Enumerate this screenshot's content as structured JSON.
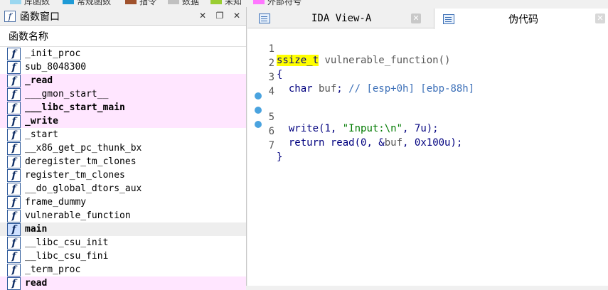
{
  "legend": [
    {
      "label": "库函数",
      "color": "#9ad7f0"
    },
    {
      "label": "常规函数",
      "color": "#1f9bd6"
    },
    {
      "label": "指令",
      "color": "#a0522d"
    },
    {
      "label": "数据",
      "color": "#c0c0c0"
    },
    {
      "label": "未知",
      "color": "#9acd32"
    },
    {
      "label": "外部符号",
      "color": "#ff77ff"
    }
  ],
  "functions_window": {
    "title": "函数窗口",
    "column_header": "函数名称",
    "items": [
      {
        "name": "_init_proc",
        "style": "normal"
      },
      {
        "name": "sub_8048300",
        "style": "normal"
      },
      {
        "name": "_read",
        "style": "import"
      },
      {
        "name": "___gmon_start__",
        "style": "import-light"
      },
      {
        "name": "___libc_start_main",
        "style": "import"
      },
      {
        "name": "_write",
        "style": "import"
      },
      {
        "name": "_start",
        "style": "normal"
      },
      {
        "name": "__x86_get_pc_thunk_bx",
        "style": "normal"
      },
      {
        "name": "deregister_tm_clones",
        "style": "normal"
      },
      {
        "name": "register_tm_clones",
        "style": "normal"
      },
      {
        "name": "__do_global_dtors_aux",
        "style": "normal"
      },
      {
        "name": "frame_dummy",
        "style": "normal"
      },
      {
        "name": "vulnerable_function",
        "style": "normal"
      },
      {
        "name": "main",
        "style": "selected"
      },
      {
        "name": "__libc_csu_init",
        "style": "normal"
      },
      {
        "name": "__libc_csu_fini",
        "style": "normal"
      },
      {
        "name": "_term_proc",
        "style": "normal"
      },
      {
        "name": "read",
        "style": "import"
      }
    ]
  },
  "tabs": {
    "ida_view": "IDA View-A",
    "pseudocode": "伪代码"
  },
  "code": {
    "line1": {
      "num": "1",
      "ret_type": "ssize_t",
      "rest": " vulnerable_function()"
    },
    "line2": {
      "num": "2",
      "text": "{"
    },
    "line3": {
      "num": "3",
      "kw": "char",
      "var": " buf",
      "semi": "; ",
      "comment": "// [esp+0h] [ebp-88h]"
    },
    "line4": {
      "num": "4"
    },
    "line5": {
      "num": "5",
      "fn": "write",
      "a": "(1, ",
      "str": "\"Input:\\n\"",
      "b": ", 7u);"
    },
    "line6": {
      "num": "6",
      "kw": "return",
      "fn": " read",
      "a": "(0, &",
      "var": "buf",
      "b": ", 0x100u);"
    },
    "line7": {
      "num": "7",
      "text": "}"
    }
  }
}
